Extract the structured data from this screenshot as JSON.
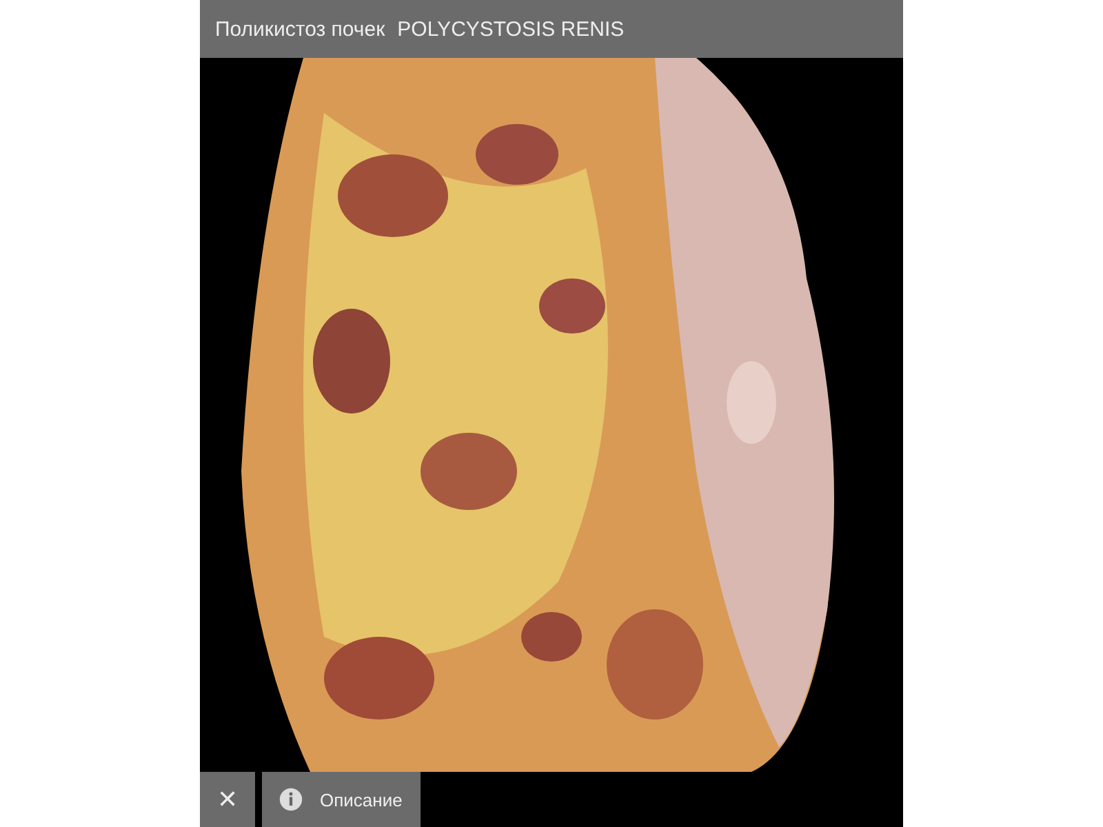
{
  "header": {
    "title_ru": "Поликистоз почек",
    "title_latin": "POLYCYSTOSIS RENIS"
  },
  "toolbar": {
    "close": "✕",
    "info_label": "Описание"
  }
}
